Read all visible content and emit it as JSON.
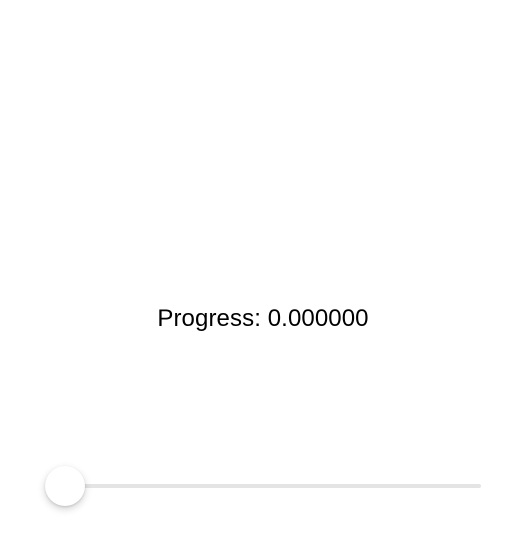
{
  "progress": {
    "label_text": "Progress: 0.000000",
    "value": 0.0
  },
  "slider": {
    "value": 0.0,
    "min": 0,
    "max": 1,
    "colors": {
      "track": "#e4e4e4",
      "fill": "#007aff",
      "thumb": "#ffffff"
    }
  }
}
